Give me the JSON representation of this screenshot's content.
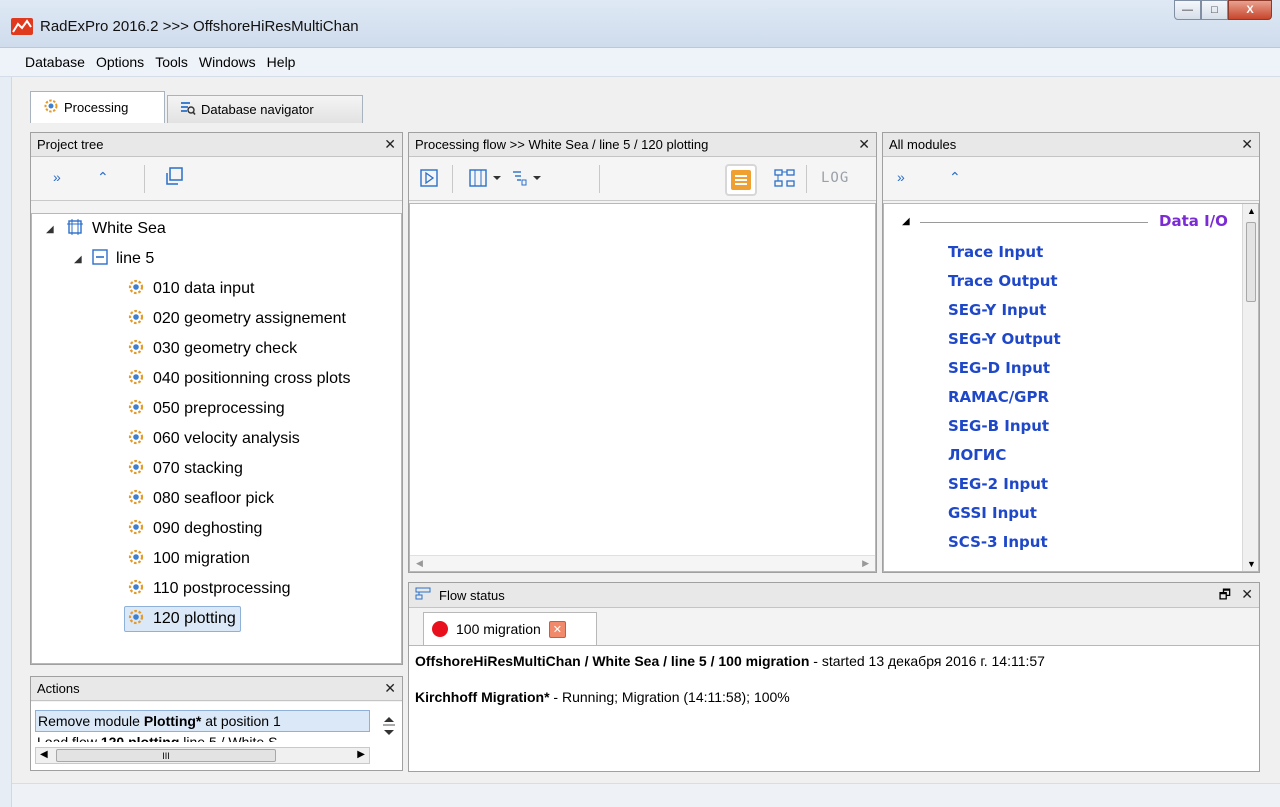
{
  "window": {
    "title": "RadExPro 2016.2 >>> OffshoreHiResMultiChan",
    "minimize_label": "—",
    "maximize_label": "□",
    "close_label": "X"
  },
  "menu": [
    "Database",
    "Options",
    "Tools",
    "Windows",
    "Help"
  ],
  "tabs": [
    {
      "label": "Processing",
      "icon": "gear-icon"
    },
    {
      "label": "Database navigator",
      "icon": "database-navigator-icon"
    }
  ],
  "project_tree": {
    "title": "Project tree",
    "close": "✕",
    "toolbar": {
      "expand": "»",
      "collapse": "⌃",
      "copy_icon": "copy-icon"
    },
    "root": "White Sea",
    "line": "line 5",
    "flows": [
      "010 data input",
      "020 geometry assignement",
      "030 geometry check",
      "040 positionning cross plots",
      "050 preprocessing",
      "060 velocity analysis",
      "070 stacking",
      "080 seafloor pick",
      "090 deghosting",
      "100 migration",
      "110 postprocessing",
      "120 plotting"
    ],
    "selected": "120 plotting"
  },
  "actions": {
    "title": "Actions",
    "close": "✕",
    "item_prefix": "Remove module ",
    "item_bold": "Plotting*",
    "item_suffix": " at position 1",
    "item2_prefix": "Load flow ",
    "item2_bold": "120 plotting",
    "item2_suffix": " line 5 / White S",
    "hscroll_grip": "III"
  },
  "processing_flow": {
    "title": "Processing flow >> White Sea / line 5 / 120 plotting",
    "close": "✕",
    "log_label": "LOG"
  },
  "all_modules": {
    "title": "All modules",
    "close": "✕",
    "toolbar": {
      "expand": "»",
      "collapse": "⌃"
    },
    "category": "Data I/O",
    "items": [
      "Trace Input",
      "Trace Output",
      "SEG-Y Input",
      "SEG-Y Output",
      "SEG-D Input",
      "RAMAC/GPR",
      "SEG-B Input",
      "ЛОГИС",
      "SEG-2 Input",
      "GSSI Input",
      "SCS-3 Input"
    ]
  },
  "flow_status": {
    "title": "Flow status",
    "tab_label": "100 migration",
    "status_color": "#e8101c",
    "line1_bold": "OffshoreHiResMultiChan / White Sea / line 5 / 100 migration",
    "line1_rest": "  -  started 13 декабря 2016 г. 14:11:57",
    "line2_bold": "Kirchhoff Migration*",
    "line2_rest": " - Running; Migration (14:11:58); 100%"
  },
  "colors": {
    "accent_blue": "#2a6fc9",
    "module_blue": "#1f48c9",
    "category_purple": "#7a2bd3",
    "highlight_orange": "#f0a030"
  }
}
